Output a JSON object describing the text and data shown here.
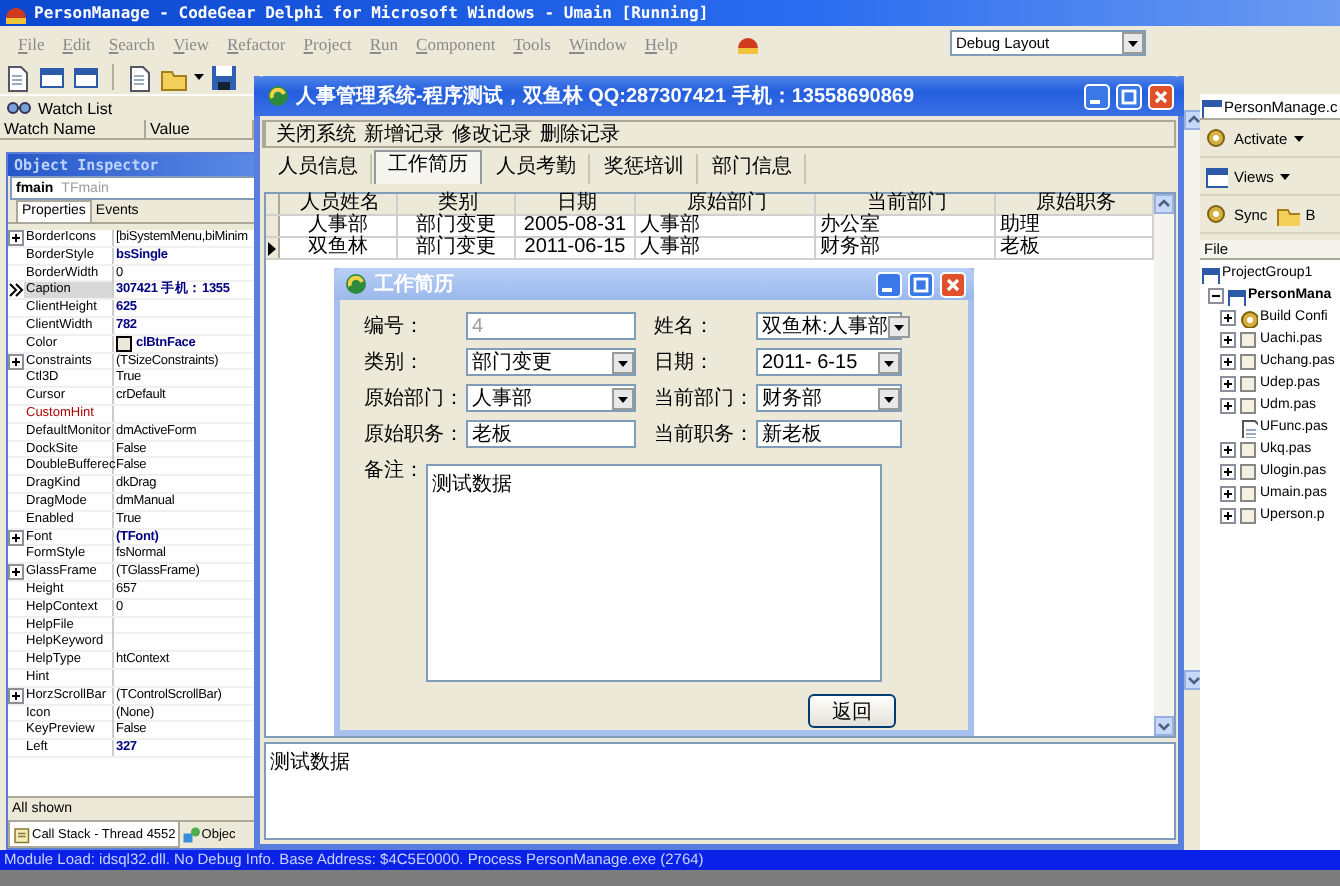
{
  "ide": {
    "title": "PersonManage - CodeGear Delphi for Microsoft Windows - Umain [Running]",
    "menu": [
      "File",
      "Edit",
      "Search",
      "View",
      "Refactor",
      "Project",
      "Run",
      "Component",
      "Tools",
      "Window",
      "Help"
    ],
    "layout_combo": "Debug Layout"
  },
  "watch_list": {
    "title": "Watch List",
    "columns": [
      "Watch Name",
      "Value"
    ]
  },
  "object_inspector": {
    "title": "Object Inspector",
    "object_name": "fmain",
    "object_class": "TFmain",
    "tabs": [
      {
        "label": "Properties",
        "selected": true
      },
      {
        "label": "Events",
        "selected": false
      }
    ],
    "properties": [
      {
        "name": "BorderIcons",
        "value": "[biSystemMenu,biMinim",
        "kind": "plain",
        "modified": false,
        "expandable": true,
        "selected": false
      },
      {
        "name": "BorderStyle",
        "value": "bsSingle",
        "kind": "plain",
        "modified": true,
        "expandable": false,
        "selected": false
      },
      {
        "name": "BorderWidth",
        "value": "0",
        "kind": "plain",
        "modified": false,
        "expandable": false,
        "selected": false
      },
      {
        "name": "Caption",
        "value": "307421 手机：1355",
        "kind": "plain",
        "modified": true,
        "expandable": false,
        "selected": true
      },
      {
        "name": "ClientHeight",
        "value": "625",
        "kind": "plain",
        "modified": true,
        "expandable": false,
        "selected": false
      },
      {
        "name": "ClientWidth",
        "value": "782",
        "kind": "plain",
        "modified": true,
        "expandable": false,
        "selected": false
      },
      {
        "name": "Color",
        "value": "clBtnFace",
        "kind": "color",
        "modified": true,
        "expandable": false,
        "selected": false
      },
      {
        "name": "Constraints",
        "value": "(TSizeConstraints)",
        "kind": "plain",
        "modified": false,
        "expandable": true,
        "selected": false
      },
      {
        "name": "Ctl3D",
        "value": "True",
        "kind": "plain",
        "modified": false,
        "expandable": false,
        "selected": false
      },
      {
        "name": "Cursor",
        "value": "crDefault",
        "kind": "plain",
        "modified": false,
        "expandable": false,
        "selected": false
      },
      {
        "name": "CustomHint",
        "kind": "link",
        "expandable": false,
        "selected": false
      },
      {
        "name": "DefaultMonitor",
        "value": "dmActiveForm",
        "kind": "plain",
        "modified": false,
        "expandable": false,
        "selected": false
      },
      {
        "name": "DockSite",
        "value": "False",
        "kind": "plain",
        "modified": false,
        "expandable": false,
        "selected": false
      },
      {
        "name": "DoubleBufferec",
        "value": "False",
        "kind": "plain",
        "modified": false,
        "expandable": false,
        "selected": false
      },
      {
        "name": "DragKind",
        "value": "dkDrag",
        "kind": "plain",
        "modified": false,
        "expandable": false,
        "selected": false
      },
      {
        "name": "DragMode",
        "value": "dmManual",
        "kind": "plain",
        "modified": false,
        "expandable": false,
        "selected": false
      },
      {
        "name": "Enabled",
        "value": "True",
        "kind": "plain",
        "modified": false,
        "expandable": false,
        "selected": false
      },
      {
        "name": "Font",
        "value": "(TFont)",
        "kind": "plain",
        "modified": true,
        "expandable": true,
        "selected": false
      },
      {
        "name": "FormStyle",
        "value": "fsNormal",
        "kind": "plain",
        "modified": false,
        "expandable": false,
        "selected": false
      },
      {
        "name": "GlassFrame",
        "value": "(TGlassFrame)",
        "kind": "plain",
        "modified": false,
        "expandable": true,
        "selected": false
      },
      {
        "name": "Height",
        "value": "657",
        "kind": "plain",
        "modified": false,
        "expandable": false,
        "selected": false
      },
      {
        "name": "HelpContext",
        "value": "0",
        "kind": "plain",
        "modified": false,
        "expandable": false,
        "selected": false
      },
      {
        "name": "HelpFile",
        "kind": "plain",
        "expandable": false,
        "selected": false
      },
      {
        "name": "HelpKeyword",
        "kind": "plain",
        "expandable": false,
        "selected": false
      },
      {
        "name": "HelpType",
        "value": "htContext",
        "kind": "plain",
        "modified": false,
        "expandable": false,
        "selected": false
      },
      {
        "name": "Hint",
        "kind": "plain",
        "expandable": false,
        "selected": false
      },
      {
        "name": "HorzScrollBar",
        "value": "(TControlScrollBar)",
        "kind": "plain",
        "modified": false,
        "expandable": true,
        "selected": false
      },
      {
        "name": "Icon",
        "value": "(None)",
        "kind": "plain",
        "modified": false,
        "expandable": false,
        "selected": false
      },
      {
        "name": "KeyPreview",
        "value": "False",
        "kind": "plain",
        "modified": false,
        "expandable": false,
        "selected": false
      },
      {
        "name": "Left",
        "value": "327",
        "kind": "plain",
        "modified": true,
        "expandable": false,
        "selected": false
      }
    ],
    "footer": "All shown"
  },
  "bottom_tabs": [
    {
      "label": "Call Stack - Thread 4552",
      "selected": true
    },
    {
      "label": "Objec",
      "selected": false
    }
  ],
  "project_manager": {
    "title": "PersonManage.c",
    "toolbar_rows": [
      {
        "buttons": [
          {
            "label": "Activate",
            "dropdown": true
          }
        ]
      },
      {
        "buttons": [
          {
            "label": "Views",
            "dropdown": true
          }
        ]
      },
      {
        "buttons": [
          {
            "label": "Sync",
            "dropdown": false
          },
          {
            "label": "B",
            "dropdown": false
          }
        ]
      }
    ],
    "column": "File",
    "tree": [
      {
        "label": "ProjectGroup1",
        "kind": "group",
        "children": [
          {
            "label": "PersonMana",
            "kind": "project",
            "expanded": true,
            "children": [
              {
                "label": "Build Confi",
                "kind": "config",
                "expanded": false
              },
              {
                "label": "Uachi.pas",
                "kind": "unit",
                "expanded": false
              },
              {
                "label": "Uchang.pas",
                "kind": "unit",
                "expanded": false
              },
              {
                "label": "Udep.pas",
                "kind": "unit",
                "expanded": false
              },
              {
                "label": "Udm.pas",
                "kind": "unit",
                "expanded": false
              },
              {
                "label": "UFunc.pas",
                "kind": "code"
              },
              {
                "label": "Ukq.pas",
                "kind": "unit",
                "expanded": false
              },
              {
                "label": "Ulogin.pas",
                "kind": "unit",
                "expanded": false
              },
              {
                "label": "Umain.pas",
                "kind": "unit",
                "expanded": false
              },
              {
                "label": "Uperson.p",
                "kind": "unit",
                "expanded": false
              }
            ]
          }
        ]
      }
    ]
  },
  "app_window": {
    "title": "人事管理系统-程序测试，双鱼林 QQ:287307421 手机：13558690869",
    "menu": [
      "关闭系统",
      "新增记录",
      "修改记录",
      "删除记录"
    ],
    "tabs": [
      {
        "label": "人员信息",
        "selected": false
      },
      {
        "label": "工作简历",
        "selected": true
      },
      {
        "label": "人员考勤",
        "selected": false
      },
      {
        "label": "奖惩培训",
        "selected": false
      },
      {
        "label": "部门信息",
        "selected": false
      }
    ],
    "grid": {
      "columns": [
        "人员姓名",
        "类别",
        "日期",
        "原始部门",
        "当前部门",
        "原始职务"
      ],
      "rows": [
        {
          "cells": [
            "人事部",
            "部门变更",
            "2005-08-31",
            "人事部",
            "办公室",
            "助理"
          ],
          "current": false
        },
        {
          "cells": [
            "双鱼林",
            "部门变更",
            "2011-06-15",
            "人事部",
            "财务部",
            "老板"
          ],
          "current": true
        }
      ]
    },
    "memo": "测试数据"
  },
  "dialog": {
    "title": "工作简历",
    "fields": [
      {
        "label": "编号：",
        "value": "4",
        "kind": "text",
        "disabled": true
      },
      {
        "label": "姓名：",
        "value": "双鱼林:人事部",
        "kind": "combo",
        "disabled": false
      },
      {
        "label": "类别：",
        "value": "部门变更",
        "kind": "combo",
        "disabled": false
      },
      {
        "label": "日期：",
        "value": "2011- 6-15",
        "kind": "combo",
        "disabled": false
      },
      {
        "label": "原始部门：",
        "value": "人事部",
        "kind": "combo",
        "disabled": false
      },
      {
        "label": "当前部门：",
        "value": "财务部",
        "kind": "combo",
        "disabled": false
      },
      {
        "label": "原始职务：",
        "value": "老板",
        "kind": "text",
        "disabled": false
      },
      {
        "label": "当前职务：",
        "value": "新老板",
        "kind": "text",
        "disabled": false
      }
    ],
    "note_label": "备注：",
    "note": "测试数据",
    "button": "返回"
  },
  "status_bar": "Module Load: idsql32.dll. No Debug Info. Base Address: $4C5E0000. Process PersonManage.exe (2764)"
}
